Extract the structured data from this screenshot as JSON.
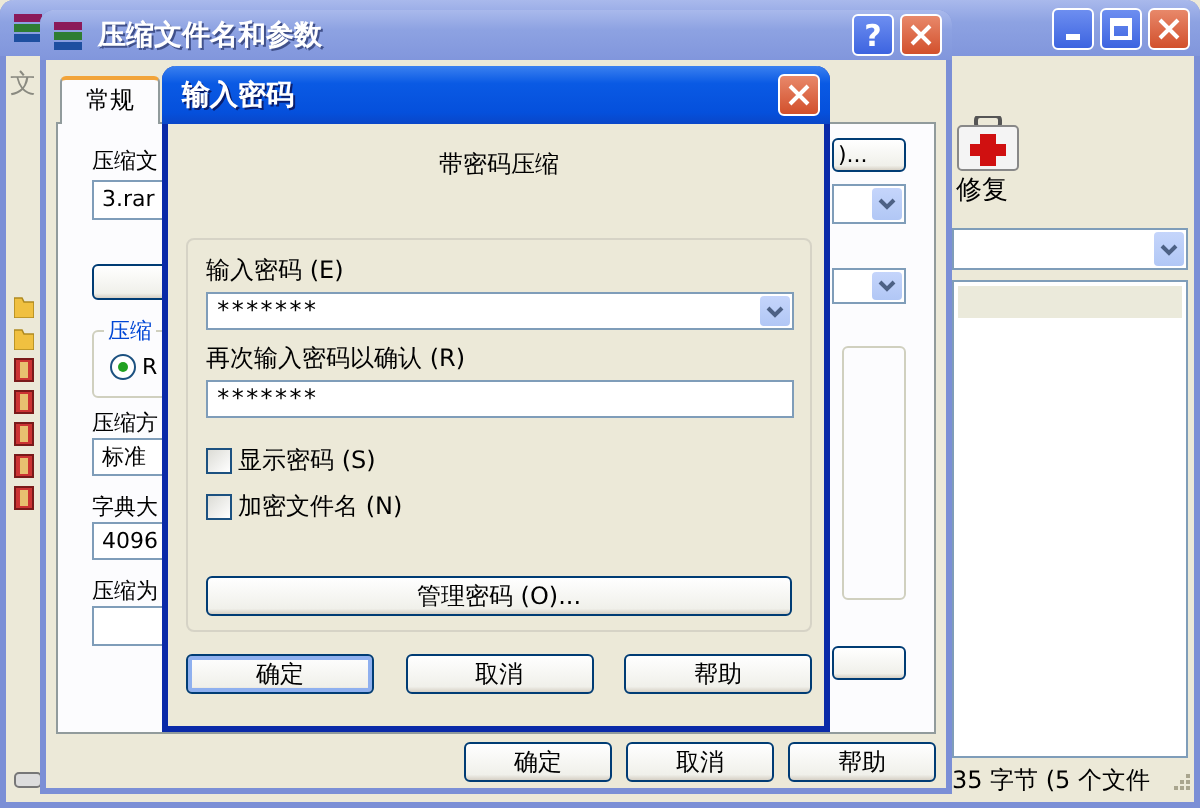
{
  "main_window": {
    "menu_item": "文",
    "toolbar": [
      {
        "label": "修复"
      }
    ],
    "file_list": [
      {
        "kind": "folder"
      },
      {
        "kind": "folder"
      },
      {
        "kind": "archive"
      },
      {
        "kind": "archive"
      },
      {
        "kind": "archive"
      },
      {
        "kind": "archive"
      },
      {
        "kind": "archive"
      }
    ],
    "status_bar": "35 字节 (5 个文件"
  },
  "archive_dialog": {
    "title": "压缩文件名和参数",
    "help_button": "?",
    "tabs": [
      {
        "label": "常规",
        "selected": true
      }
    ],
    "archive_name_label": "压缩文",
    "archive_name": "3.rar",
    "browse_button": ")...",
    "format_group": "压缩",
    "format_option": {
      "label": "R",
      "selected": true
    },
    "method_label": "压缩方",
    "method": "标准",
    "dictionary_label": "字典大",
    "dictionary": "4096",
    "split_label": "压缩为",
    "buttons": [
      "确定",
      "取消",
      "帮助"
    ]
  },
  "password_dialog": {
    "title": "输入密码",
    "heading": "带密码压缩",
    "password_label": "输入密码 (E)",
    "password": "*******",
    "confirm_label": "再次输入密码以确认 (R)",
    "confirm": "*******",
    "options": [
      {
        "label": "显示密码 (S)",
        "checked": false
      },
      {
        "label": "加密文件名 (N)",
        "checked": false
      }
    ],
    "manage_button": "管理密码 (O)...",
    "buttons": [
      {
        "label": "确定",
        "default": true
      },
      {
        "label": "取消",
        "default": false
      },
      {
        "label": "帮助",
        "default": false
      }
    ]
  }
}
